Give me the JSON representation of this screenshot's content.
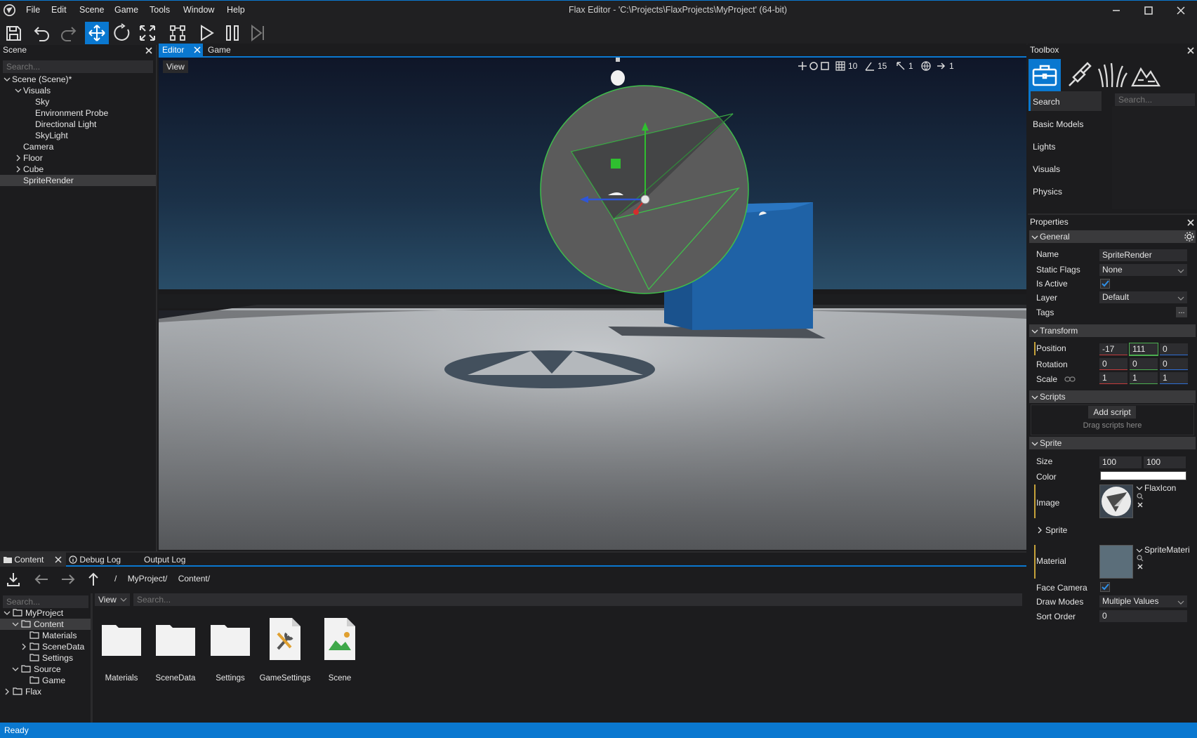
{
  "window": {
    "title": "Flax Editor - 'C:\\Projects\\FlaxProjects\\MyProject' (64-bit)",
    "menu": [
      "File",
      "Edit",
      "Scene",
      "Game",
      "Tools",
      "Window",
      "Help"
    ]
  },
  "toolbar": {
    "icons": [
      "save-icon",
      "undo-icon",
      "redo-icon",
      "translate-icon",
      "rotate-icon",
      "scale-icon",
      "build-icon",
      "play-icon",
      "pause-icon",
      "step-icon"
    ],
    "active": "translate-icon"
  },
  "scene_panel": {
    "title": "Scene",
    "search_placeholder": "Search...",
    "items": [
      "Scene (Scene)*",
      "Visuals",
      "Sky",
      "Environment Probe",
      "Directional Light",
      "SkyLight",
      "Camera",
      "Floor",
      "Cube",
      "SpriteRender"
    ],
    "selected": "SpriteRender"
  },
  "editor_tabs": {
    "tabs": [
      "Editor",
      "Game"
    ],
    "active": "Editor",
    "view_button": "View"
  },
  "viewport_toolbar": {
    "grid": "10",
    "angle": "15",
    "scale": "1",
    "speed": "1"
  },
  "toolbox": {
    "title": "Toolbox",
    "icons": [
      "toolbox-icon",
      "paint-icon",
      "foliage-icon",
      "terrain-icon"
    ],
    "categories": [
      "Search",
      "Basic Models",
      "Lights",
      "Visuals",
      "Physics"
    ],
    "search_placeholder": "Search..."
  },
  "properties": {
    "title": "Properties",
    "general": {
      "header": "General",
      "name_label": "Name",
      "name_value": "SpriteRender",
      "static_flags_label": "Static Flags",
      "static_flags_value": "None",
      "is_active_label": "Is Active",
      "layer_label": "Layer",
      "layer_value": "Default",
      "tags_label": "Tags",
      "tags_button": "..."
    },
    "transform": {
      "header": "Transform",
      "position_label": "Position",
      "position": [
        "-17",
        "111",
        "0"
      ],
      "rotation_label": "Rotation",
      "rotation": [
        "0",
        "0",
        "0"
      ],
      "scale_label": "Scale",
      "scale": [
        "1",
        "1",
        "1"
      ]
    },
    "scripts": {
      "header": "Scripts",
      "add_button": "Add script",
      "hint": "Drag scripts here"
    },
    "sprite": {
      "header": "Sprite",
      "size_label": "Size",
      "size": [
        "100",
        "100"
      ],
      "color_label": "Color",
      "color_value": "#ffffff",
      "image_label": "Image",
      "image_asset": "FlaxIcon",
      "sprite_sub": "Sprite",
      "material_label": "Material",
      "material_asset": "SpriteMateri",
      "face_camera_label": "Face Camera",
      "draw_modes_label": "Draw Modes",
      "draw_modes_value": "Multiple Values",
      "sort_order_label": "Sort Order",
      "sort_order_value": "0"
    }
  },
  "content_panel": {
    "tabs": [
      "Content",
      "Debug Log",
      "Output Log"
    ],
    "active": "Content",
    "breadcrumb": [
      "/",
      "MyProject/",
      "Content/"
    ],
    "tree_search_placeholder": "Search...",
    "tree": [
      "MyProject",
      "Content",
      "Materials",
      "SceneData",
      "Settings",
      "Source",
      "Game",
      "Flax"
    ],
    "view_button": "View",
    "search_placeholder": "Search...",
    "items": [
      {
        "label": "Materials",
        "icon": "folder-icon"
      },
      {
        "label": "SceneData",
        "icon": "folder-icon"
      },
      {
        "label": "Settings",
        "icon": "folder-icon"
      },
      {
        "label": "GameSettings",
        "icon": "settings-asset-icon"
      },
      {
        "label": "Scene",
        "icon": "scene-asset-icon"
      }
    ]
  },
  "status": {
    "text": "Ready"
  },
  "colors": {
    "accent": "#0a78d0",
    "panel": "#1c1c1e",
    "field": "#2d2d30",
    "x_axis": "#c43c3c",
    "y_axis": "#4caf50",
    "z_axis": "#2f6fd6"
  }
}
